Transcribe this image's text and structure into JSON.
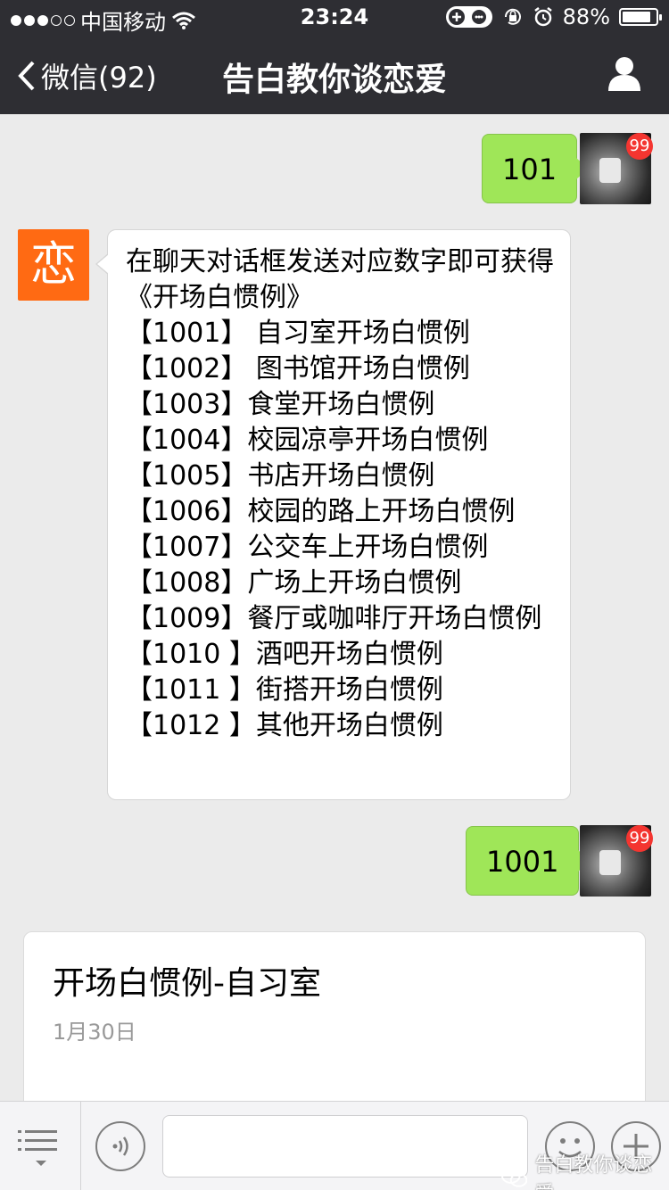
{
  "status_bar": {
    "carrier": "中国移动",
    "time": "23:24",
    "battery_percent_text": "88%",
    "battery_level": 0.88,
    "signal_bars_filled": 3,
    "signal_bars_total": 5
  },
  "nav": {
    "back_label": "微信(92)",
    "title": "告白教你谈恋爱"
  },
  "messages": {
    "sent_1": {
      "text": "101",
      "badge": "99"
    },
    "received": {
      "avatar_char": "恋",
      "intro": "在聊天对话框发送对应数字即可获得《开场白惯例》",
      "lines": [
        "【1001】 自习室开场白惯例",
        "【1002】 图书馆开场白惯例",
        "【1003】食堂开场白惯例",
        "【1004】校园凉亭开场白惯例",
        "【1005】书店开场白惯例",
        "【1006】校园的路上开场白惯例",
        "【1007】公交车上开场白惯例",
        "【1008】广场上开场白惯例",
        "【1009】餐厅或咖啡厅开场白惯例",
        "【1010 】酒吧开场白惯例",
        "【1011 】街搭开场白惯例",
        "【1012 】其他开场白惯例"
      ]
    },
    "sent_2": {
      "text": "1001",
      "badge": "99"
    }
  },
  "article": {
    "title": "开场白惯例-自习室",
    "date": "1月30日"
  },
  "toolbar": {
    "input_placeholder": ""
  },
  "watermark": {
    "text": "告白教你谈恋爱"
  },
  "colors": {
    "nav_bg": "#2e2e33",
    "chat_bg": "#ebebeb",
    "sent_bubble": "#9fe658",
    "bot_avatar": "#ff6a13",
    "badge": "#f43530"
  }
}
